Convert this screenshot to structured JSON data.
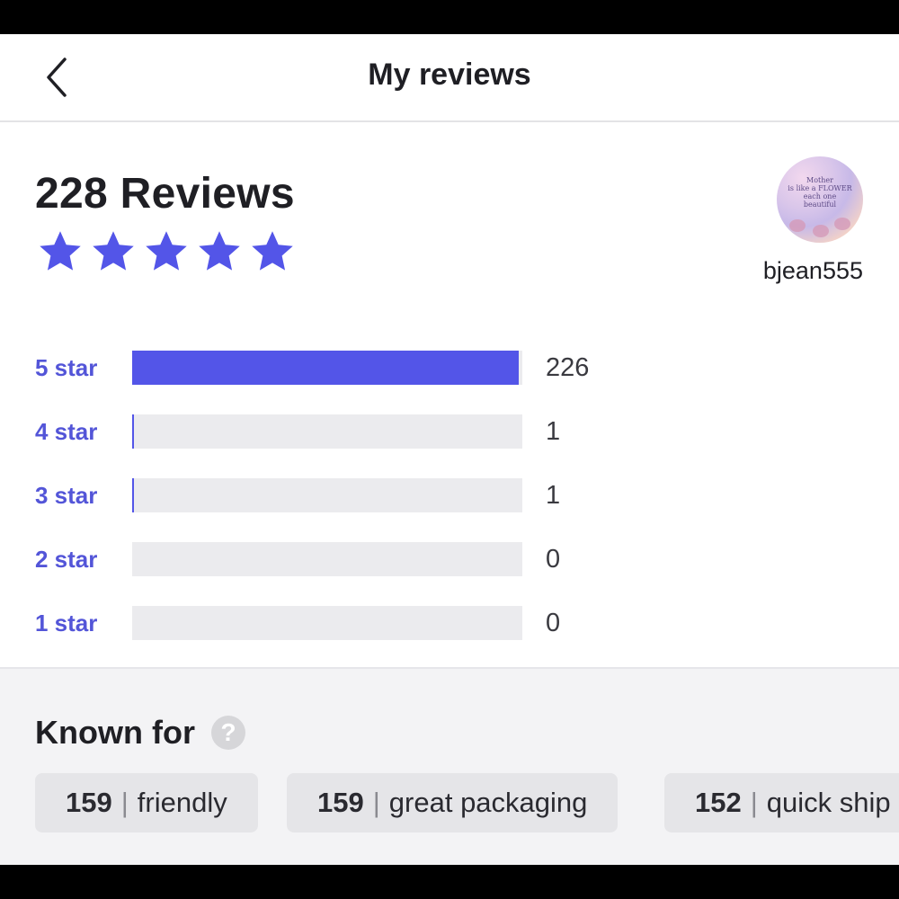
{
  "header": {
    "title": "My reviews",
    "back_icon": "chevron-left-icon"
  },
  "summary": {
    "count_text": "228 Reviews",
    "stars": 5,
    "star_color": "#5355e8",
    "username": "bjean555",
    "avatar_text": "Mother is like a FLOWER each one beautiful"
  },
  "distribution": [
    {
      "label": "5 star",
      "count": "226",
      "fraction": 0.991
    },
    {
      "label": "4 star",
      "count": "1",
      "fraction": 0.0044
    },
    {
      "label": "3 star",
      "count": "1",
      "fraction": 0.0044
    },
    {
      "label": "2 star",
      "count": "0",
      "fraction": 0
    },
    {
      "label": "1 star",
      "count": "0",
      "fraction": 0
    }
  ],
  "known_for": {
    "title": "Known for",
    "help_icon": "question-mark-icon",
    "chips": [
      {
        "count": "159",
        "label": "friendly"
      },
      {
        "count": "159",
        "label": "great packaging"
      },
      {
        "count": "152",
        "label": "quick ship"
      }
    ]
  },
  "colors": {
    "accent": "#5355e8",
    "label_accent": "#5355d8",
    "track": "#ebebee"
  }
}
